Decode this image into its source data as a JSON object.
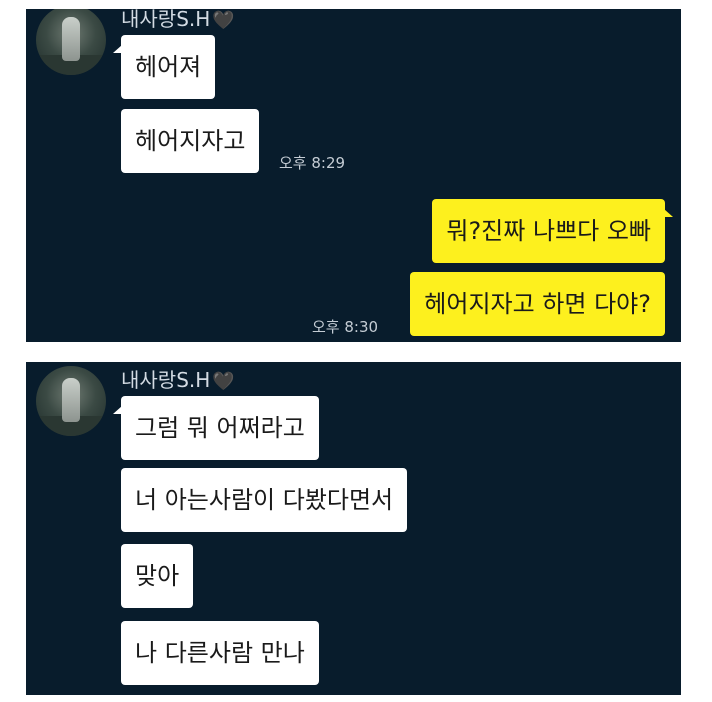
{
  "panel1": {
    "sender_name": "내사랑S.H",
    "name_heart": "🖤",
    "messages_in": [
      "헤어져",
      "헤어지자고"
    ],
    "time_in": "오후 8:29",
    "messages_out": [
      "뭐?진짜 나쁘다 오빠",
      "헤어지자고 하면 다야?"
    ],
    "time_out": "오후 8:30"
  },
  "panel2": {
    "sender_name": "내사랑S.H",
    "name_heart": "🖤",
    "messages_in": [
      "그럼 뭐 어쩌라고",
      "너 아는사람이 다봤다면서",
      "맞아",
      "나 다른사람 만나"
    ]
  },
  "colors": {
    "background": "#081c2c",
    "incoming_bubble": "#ffffff",
    "outgoing_bubble": "#fdf01e"
  },
  "icons": {
    "avatar": "profile-photo",
    "heart": "black-heart-icon"
  }
}
